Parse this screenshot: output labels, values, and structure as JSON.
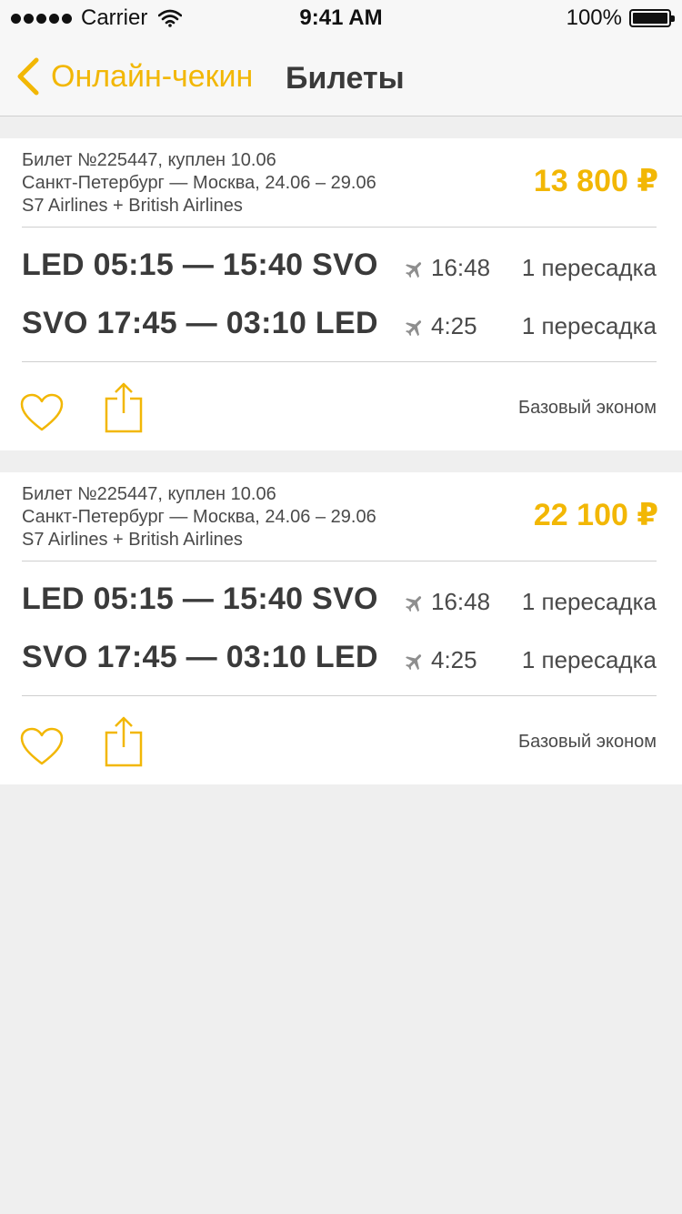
{
  "status_bar": {
    "carrier": "Carrier",
    "time": "9:41 AM",
    "battery": "100%"
  },
  "nav": {
    "back_label": "Онлайн-чекин",
    "title": "Билеты"
  },
  "colors": {
    "accent": "#f2b705",
    "text": "#3a3a3a",
    "background": "#efefef"
  },
  "tickets": [
    {
      "number": "Билет №225447, куплен 10.06",
      "route_summary": "Санкт-Петербург — Москва, 24.06 – 29.06",
      "airlines": "S7 Airlines + British Airlines",
      "price": "13 800 ₽",
      "legs": [
        {
          "route": "LED 05:15 — 15:40 SVO",
          "duration": "16:48",
          "stops": "1 пересадка"
        },
        {
          "route": "SVO 17:45 — 03:10 LED",
          "duration": "4:25",
          "stops": "1 пересадка"
        }
      ],
      "fare_class": "Базовый эконом"
    },
    {
      "number": "Билет №225447, куплен 10.06",
      "route_summary": "Санкт-Петербург — Москва, 24.06 – 29.06",
      "airlines": "S7 Airlines + British Airlines",
      "price": "22 100 ₽",
      "legs": [
        {
          "route": "LED 05:15 — 15:40 SVO",
          "duration": "16:48",
          "stops": "1 пересадка"
        },
        {
          "route": "SVO 17:45 — 03:10 LED",
          "duration": "4:25",
          "stops": "1 пересадка"
        }
      ],
      "fare_class": "Базовый эконом"
    }
  ]
}
